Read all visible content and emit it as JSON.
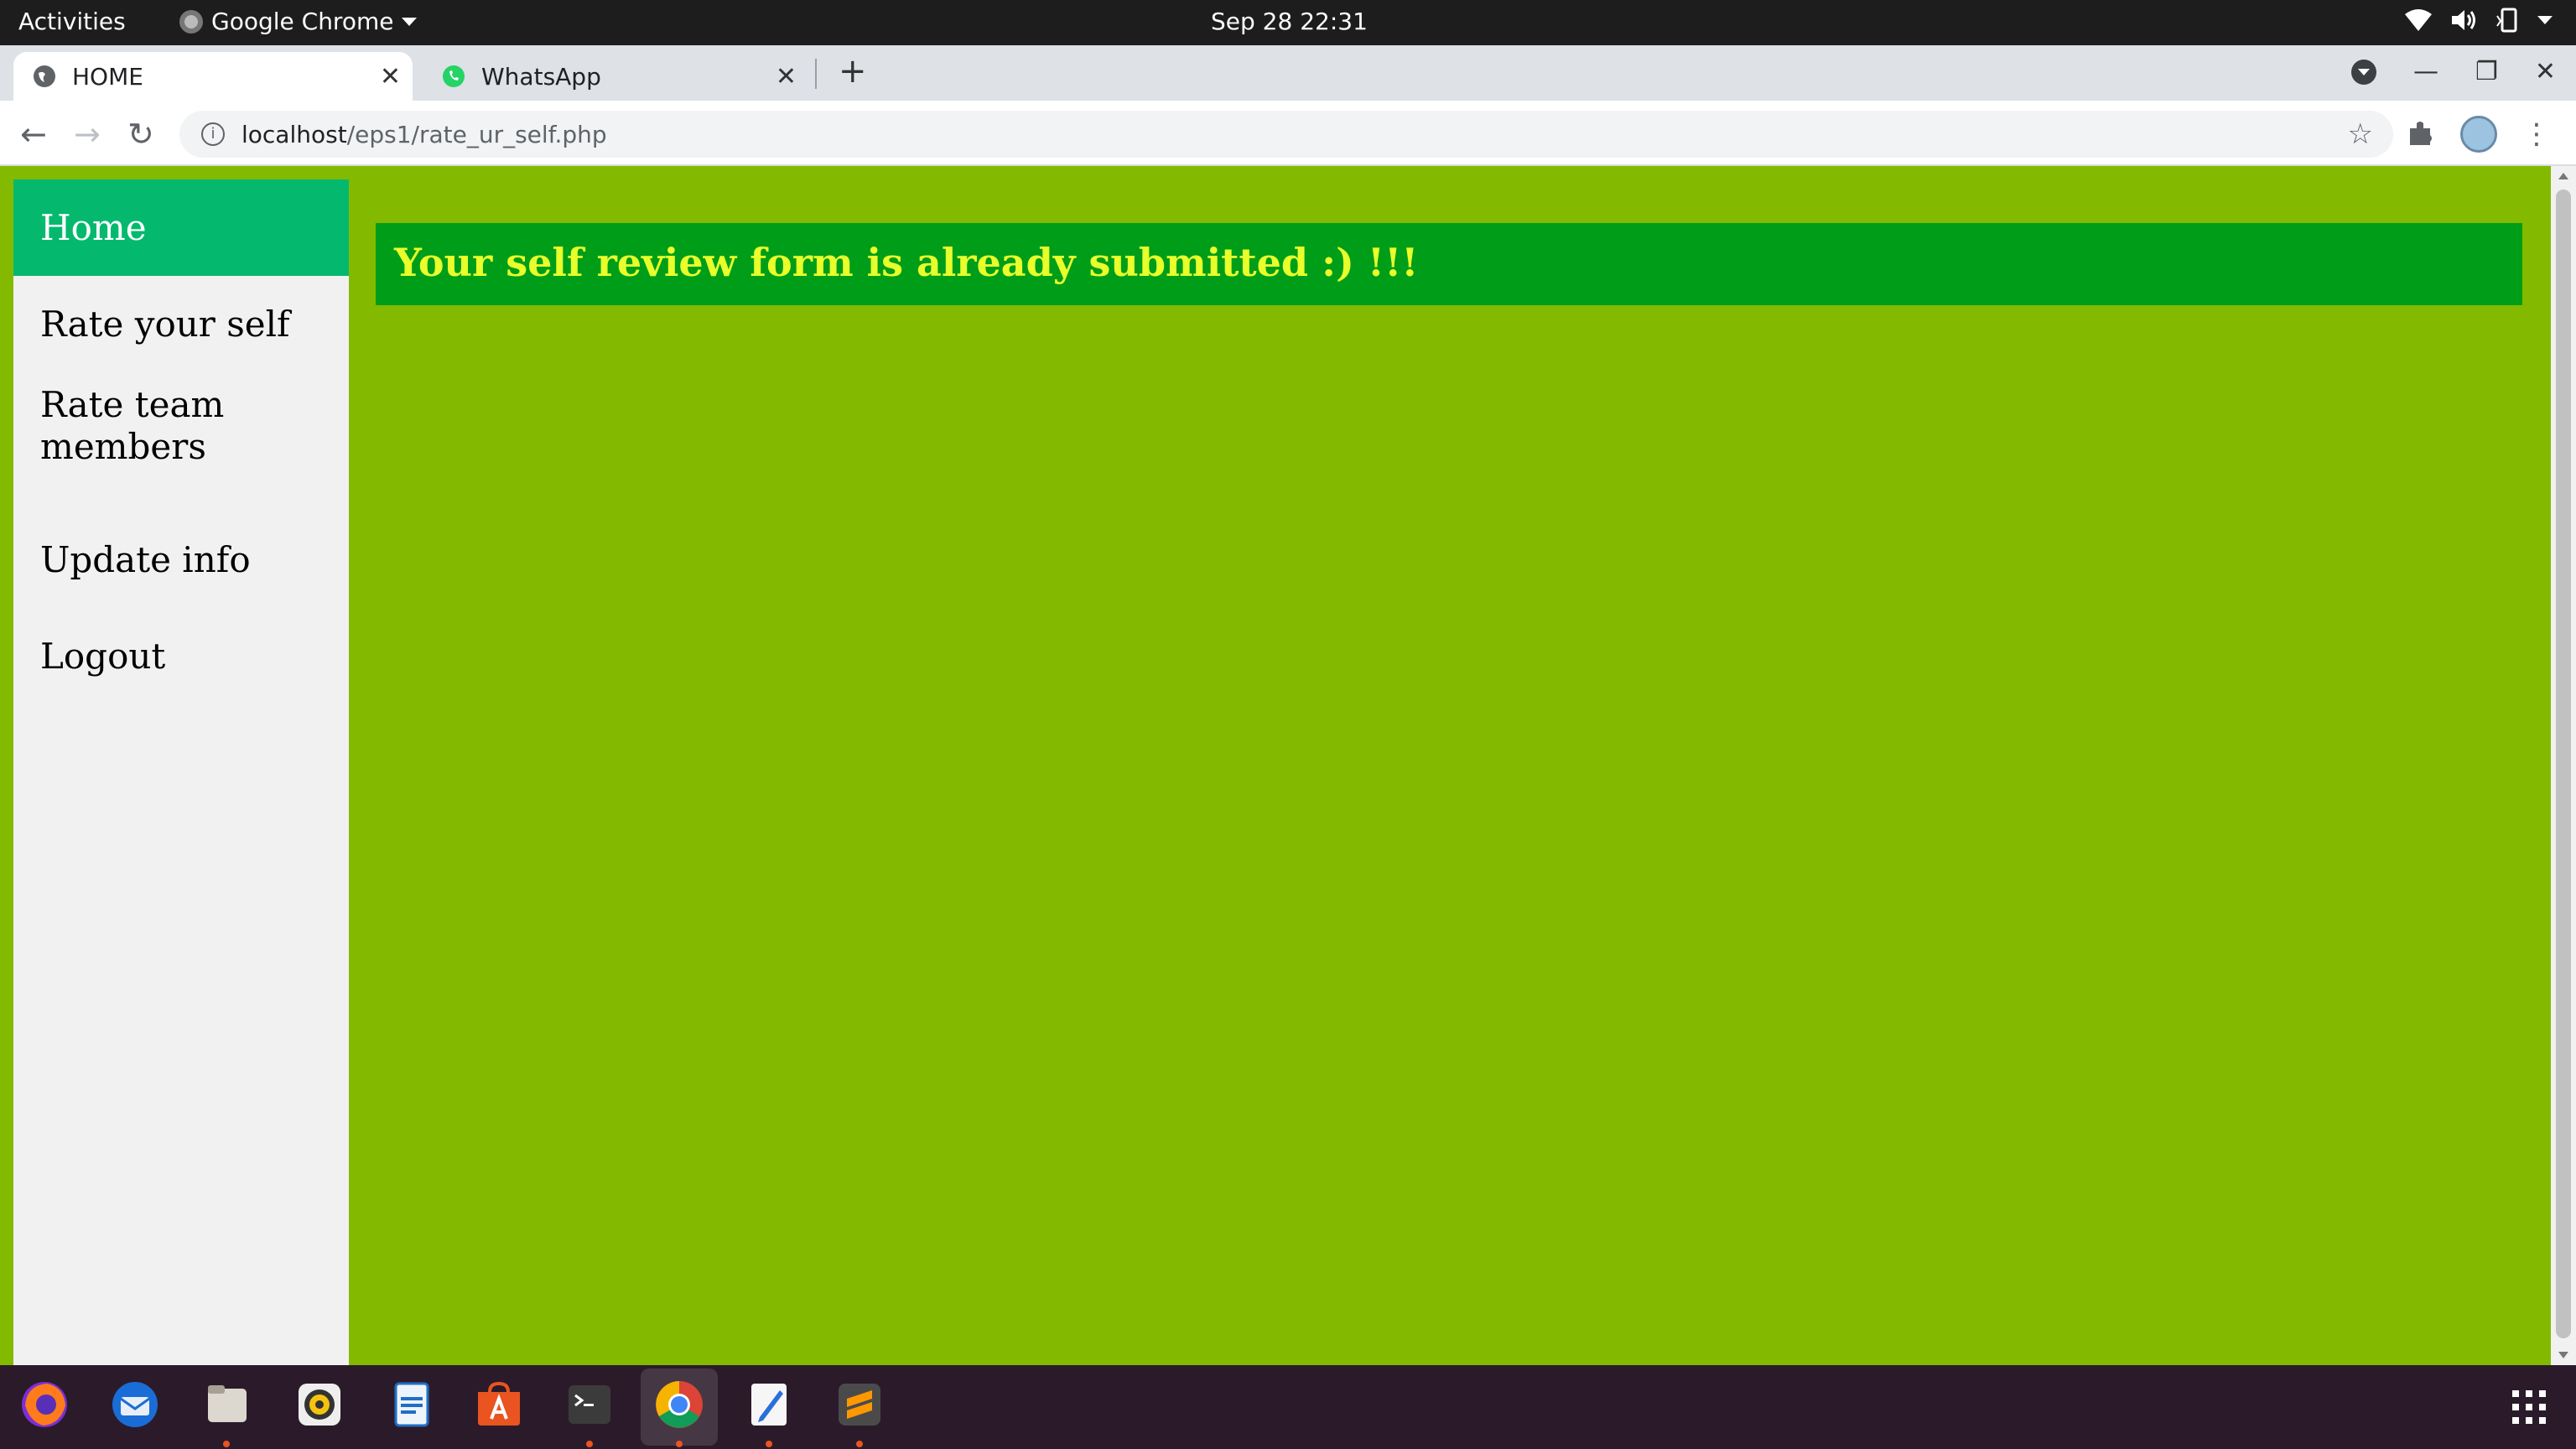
{
  "topbar": {
    "activities": "Activities",
    "app_name": "Google Chrome",
    "clock": "Sep 28  22:31"
  },
  "tabs": [
    {
      "label": "HOME",
      "icon": "globe-icon",
      "active": true
    },
    {
      "label": "WhatsApp",
      "icon": "whatsapp-icon",
      "active": false
    }
  ],
  "address_bar": {
    "host": "localhost",
    "path": "/eps1/rate_ur_self.php"
  },
  "sidebar": {
    "items": [
      {
        "label": "Home",
        "active": true
      },
      {
        "label": "Rate your self"
      },
      {
        "label": "Rate team members"
      },
      {
        "label": "Update info"
      },
      {
        "label": "Logout"
      }
    ]
  },
  "banner": {
    "message": "Your self review form is already submitted :) !!!"
  },
  "colors": {
    "page_bg": "#83ba00",
    "banner_bg": "#009e18",
    "banner_text": "#e9ff2b",
    "active_nav": "#04b96e"
  },
  "dock": {
    "apps": [
      "firefox-icon",
      "thunderbird-icon",
      "files-icon",
      "rhythmbox-icon",
      "writer-icon",
      "software-icon",
      "terminal-icon",
      "chrome-icon",
      "text-editor-icon",
      "sublime-icon"
    ]
  }
}
